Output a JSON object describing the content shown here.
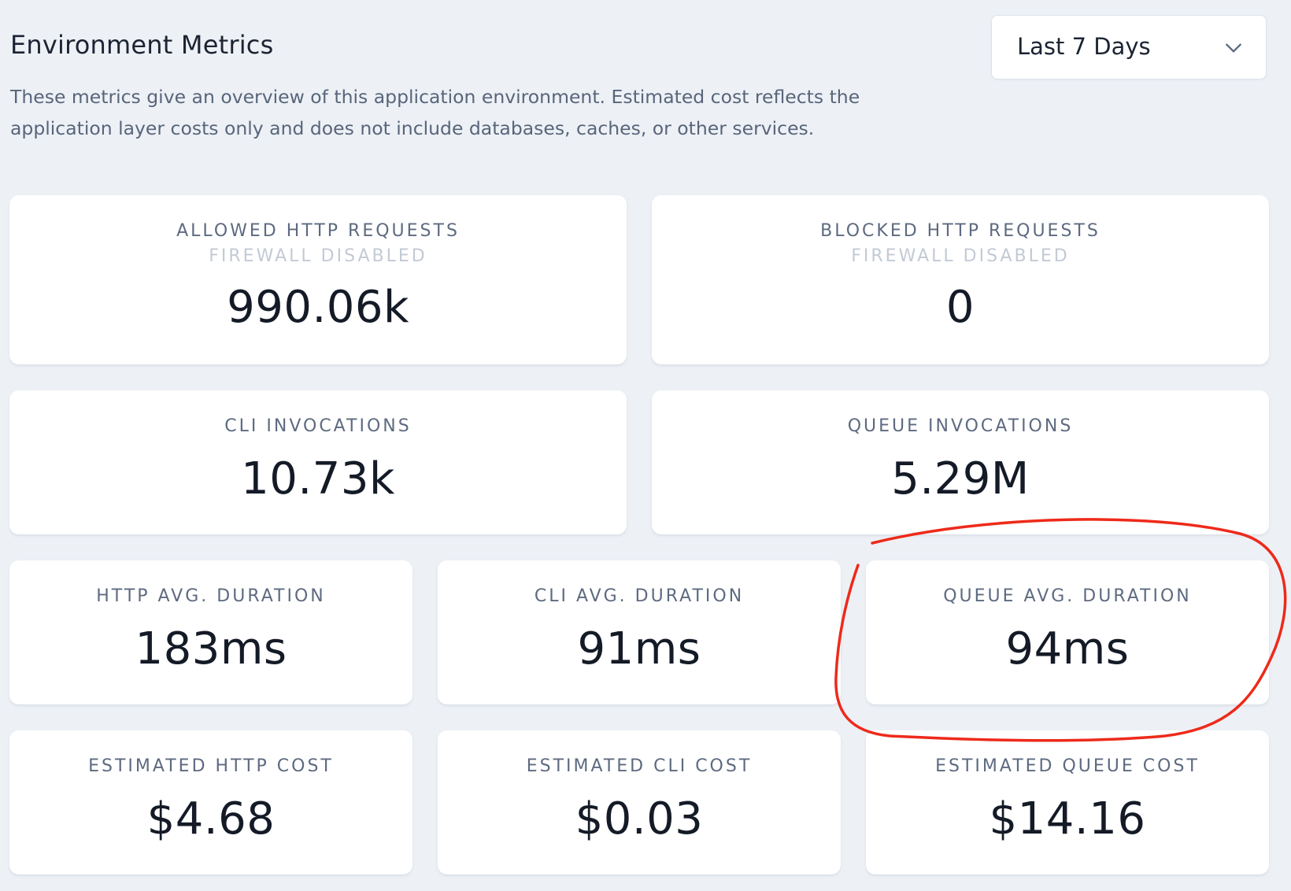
{
  "header": {
    "title": "Environment Metrics",
    "description": "These metrics give an overview of this application environment. Estimated cost reflects the application layer costs only and does not include databases, caches, or other services."
  },
  "range_select": {
    "selected": "Last 7 Days",
    "icon": "chevron-down-icon"
  },
  "metrics": {
    "allowed_http": {
      "label": "ALLOWED HTTP REQUESTS",
      "sublabel": "FIREWALL DISABLED",
      "value": "990.06k"
    },
    "blocked_http": {
      "label": "BLOCKED HTTP REQUESTS",
      "sublabel": "FIREWALL DISABLED",
      "value": "0"
    },
    "cli_invocations": {
      "label": "CLI INVOCATIONS",
      "value": "10.73k"
    },
    "queue_invocations": {
      "label": "QUEUE INVOCATIONS",
      "value": "5.29M"
    },
    "http_avg_duration": {
      "label": "HTTP AVG. DURATION",
      "value": "183ms"
    },
    "cli_avg_duration": {
      "label": "CLI AVG. DURATION",
      "value": "91ms"
    },
    "queue_avg_duration": {
      "label": "QUEUE AVG. DURATION",
      "value": "94ms"
    },
    "est_http_cost": {
      "label": "ESTIMATED HTTP COST",
      "value": "$4.68"
    },
    "est_cli_cost": {
      "label": "ESTIMATED CLI COST",
      "value": "$0.03"
    },
    "est_queue_cost": {
      "label": "ESTIMATED QUEUE COST",
      "value": "$14.16"
    }
  },
  "colors": {
    "background": "#edf1f6",
    "card": "#ffffff",
    "label": "#5d6a80",
    "sublabel": "#c3cad5",
    "value": "#141b27",
    "annotation": "#ee2a1a"
  }
}
